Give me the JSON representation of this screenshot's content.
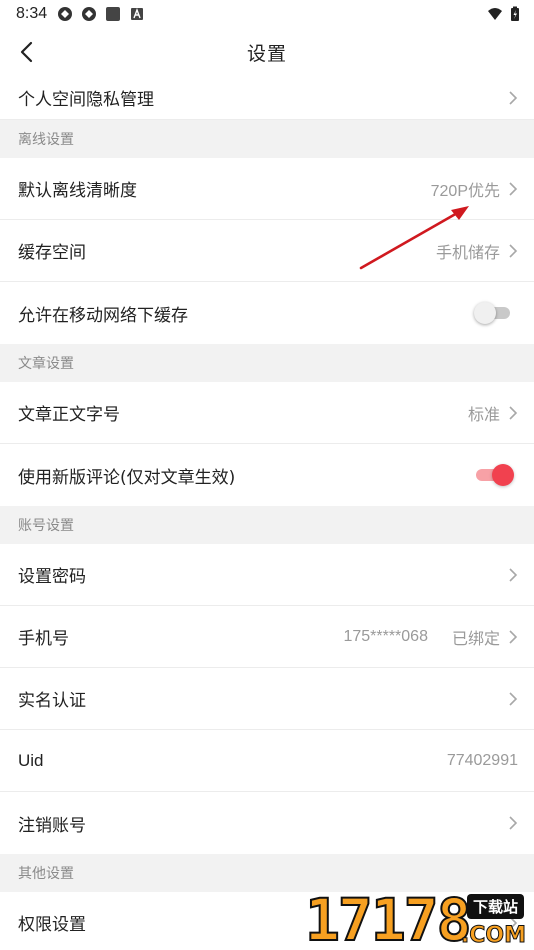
{
  "status_bar": {
    "time": "8:34",
    "left_icons": [
      "sync-icon",
      "sync-icon",
      "app-square-icon",
      "a-badge-icon"
    ],
    "right_icons": [
      "wifi-icon",
      "battery-charging-icon"
    ]
  },
  "nav": {
    "title": "设置",
    "back_icon": "chevron-left-icon"
  },
  "rows_top": [
    {
      "label": "个人空间隐私管理",
      "value": ""
    }
  ],
  "sections": {
    "offline": {
      "header": "离线设置",
      "default_quality": {
        "label": "默认离线清晰度",
        "value": "720P优先"
      },
      "cache_space": {
        "label": "缓存空间",
        "value": "手机储存"
      },
      "mobile_cache": {
        "label": "允许在移动网络下缓存",
        "toggle": false
      }
    },
    "article": {
      "header": "文章设置",
      "font_size": {
        "label": "文章正文字号",
        "value": "标准"
      },
      "new_comments": {
        "label": "使用新版评论(仅对文章生效)",
        "toggle": true
      }
    },
    "account": {
      "header": "账号设置",
      "password": {
        "label": "设置密码"
      },
      "phone": {
        "label": "手机号",
        "number": "175*****068",
        "status": "已绑定"
      },
      "realname": {
        "label": "实名认证"
      },
      "uid": {
        "label": "Uid",
        "value": "77402991"
      },
      "delete": {
        "label": "注销账号"
      }
    },
    "other": {
      "header": "其他设置",
      "permissions": {
        "label": "权限设置"
      }
    }
  },
  "watermark": {
    "digits": "17178",
    "badge": "下载站",
    "suffix": ".COM"
  },
  "colors": {
    "accent": "#f1414f",
    "accent_track": "#f7a1a6",
    "annotation_arrow": "#d0191f",
    "watermark_orange": "#f7a021"
  }
}
